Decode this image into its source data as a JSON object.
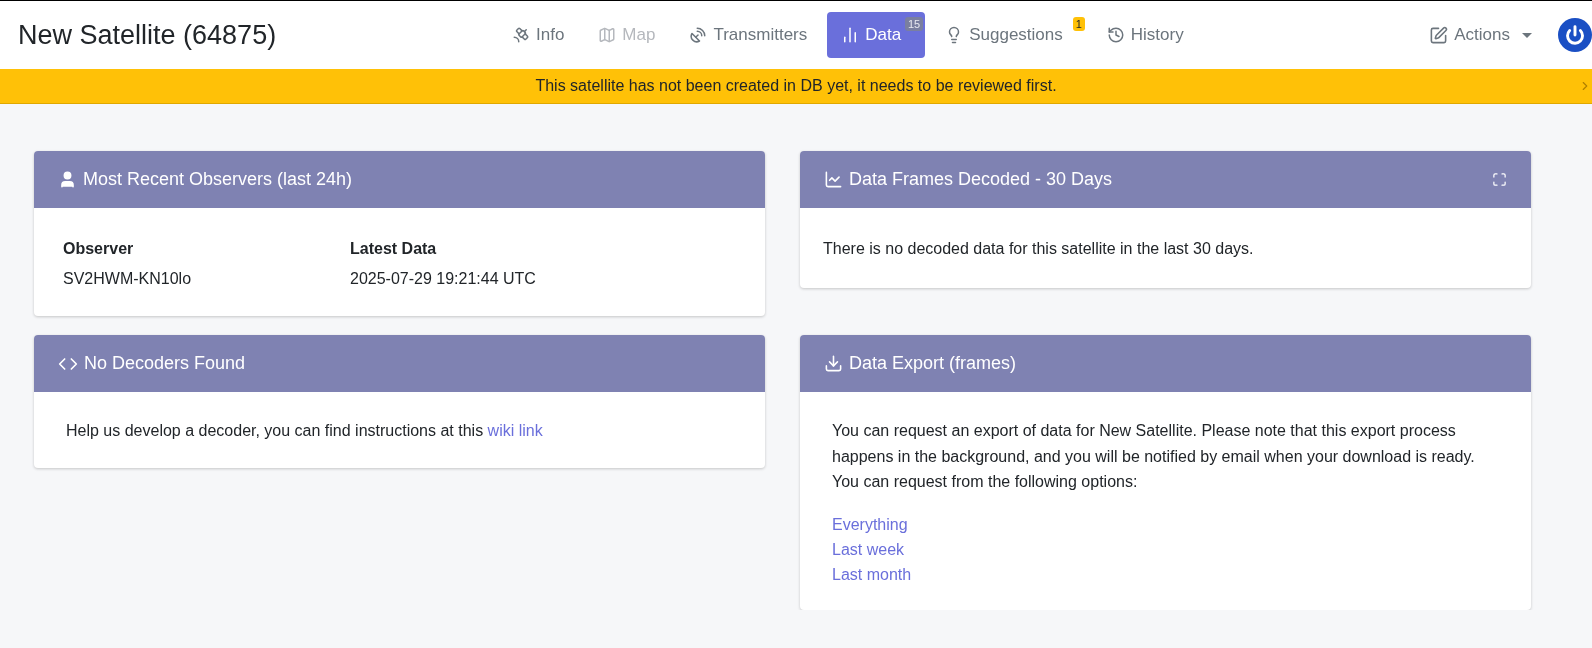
{
  "title": "New Satellite (64875)",
  "tabs": [
    {
      "label": "Info",
      "selected": false,
      "disabled": false
    },
    {
      "label": "Map",
      "selected": false,
      "disabled": true
    },
    {
      "label": "Transmitters",
      "selected": false,
      "disabled": false
    },
    {
      "label": "Data",
      "selected": true,
      "disabled": false,
      "badge": {
        "text": "15",
        "kind": "count"
      }
    },
    {
      "label": "Suggestions",
      "selected": false,
      "disabled": false,
      "badge": {
        "text": "1",
        "kind": "warning"
      }
    },
    {
      "label": "History",
      "selected": false,
      "disabled": false
    }
  ],
  "actions": {
    "label": "Actions"
  },
  "banner": {
    "text": "This satellite has not been created in DB yet, it needs to be reviewed first."
  },
  "observers_card": {
    "title": "Most Recent Observers (last 24h)",
    "columns": [
      "Observer",
      "Latest Data"
    ],
    "rows": [
      [
        "SV2HWM-KN10lo",
        "2025-07-29 19:21:44 UTC"
      ]
    ]
  },
  "decoders_card": {
    "title": "No Decoders Found",
    "text": "Help us develop a decoder, you can find instructions at this",
    "link": "wiki link"
  },
  "frames_card": {
    "title": "Data Frames Decoded - 30 Days",
    "text": "There is no decoded data for this satellite in the last 30 days."
  },
  "export_card": {
    "title": "Data Export (frames)",
    "text": "You can request an export of data for New Satellite. Please note that this export process happens in the background, and you will be notified by email when your download is ready. You can request from the following options:",
    "links": [
      "Everything",
      "Last week",
      "Last month"
    ]
  }
}
